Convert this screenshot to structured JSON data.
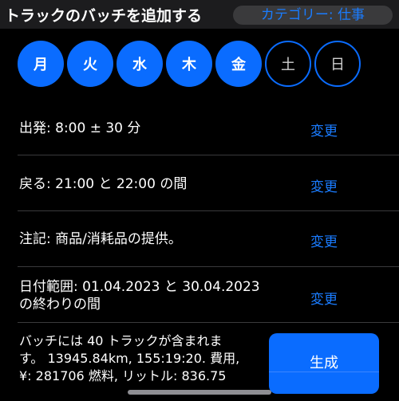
{
  "header": {
    "title": "トラックのバッチを追加する",
    "category": "カテゴリー: 仕事"
  },
  "weekdays": [
    {
      "label": "月",
      "selected": true
    },
    {
      "label": "火",
      "selected": true
    },
    {
      "label": "水",
      "selected": true
    },
    {
      "label": "木",
      "selected": true
    },
    {
      "label": "金",
      "selected": true
    },
    {
      "label": "土",
      "selected": false
    },
    {
      "label": "日",
      "selected": false
    }
  ],
  "rows": {
    "departure": {
      "label": "出発: 8:00 ± 30 分",
      "action": "変更"
    },
    "return": {
      "label": "戻る: 21:00 と 22:00 の間",
      "action": "変更"
    },
    "note": {
      "label": "注記: 商品/消耗品の提供。",
      "action": "変更"
    },
    "date_range": {
      "line1": "日付範囲:  01.04.2023 と 30.04.2023",
      "line2": "の終わりの間",
      "action": "変更"
    }
  },
  "summary": {
    "line1": "バッチには 40 トラックが含まれま",
    "line2": "す。 13945.84km, 155:19:20. 費用,",
    "line3": "¥: 281706 燃料, リットル: 836.75"
  },
  "generate_button": {
    "label": "生成"
  },
  "colors": {
    "accent": "#0a6cff",
    "link": "#1a7cff",
    "background": "#000000",
    "header": "#1c1c1e"
  }
}
